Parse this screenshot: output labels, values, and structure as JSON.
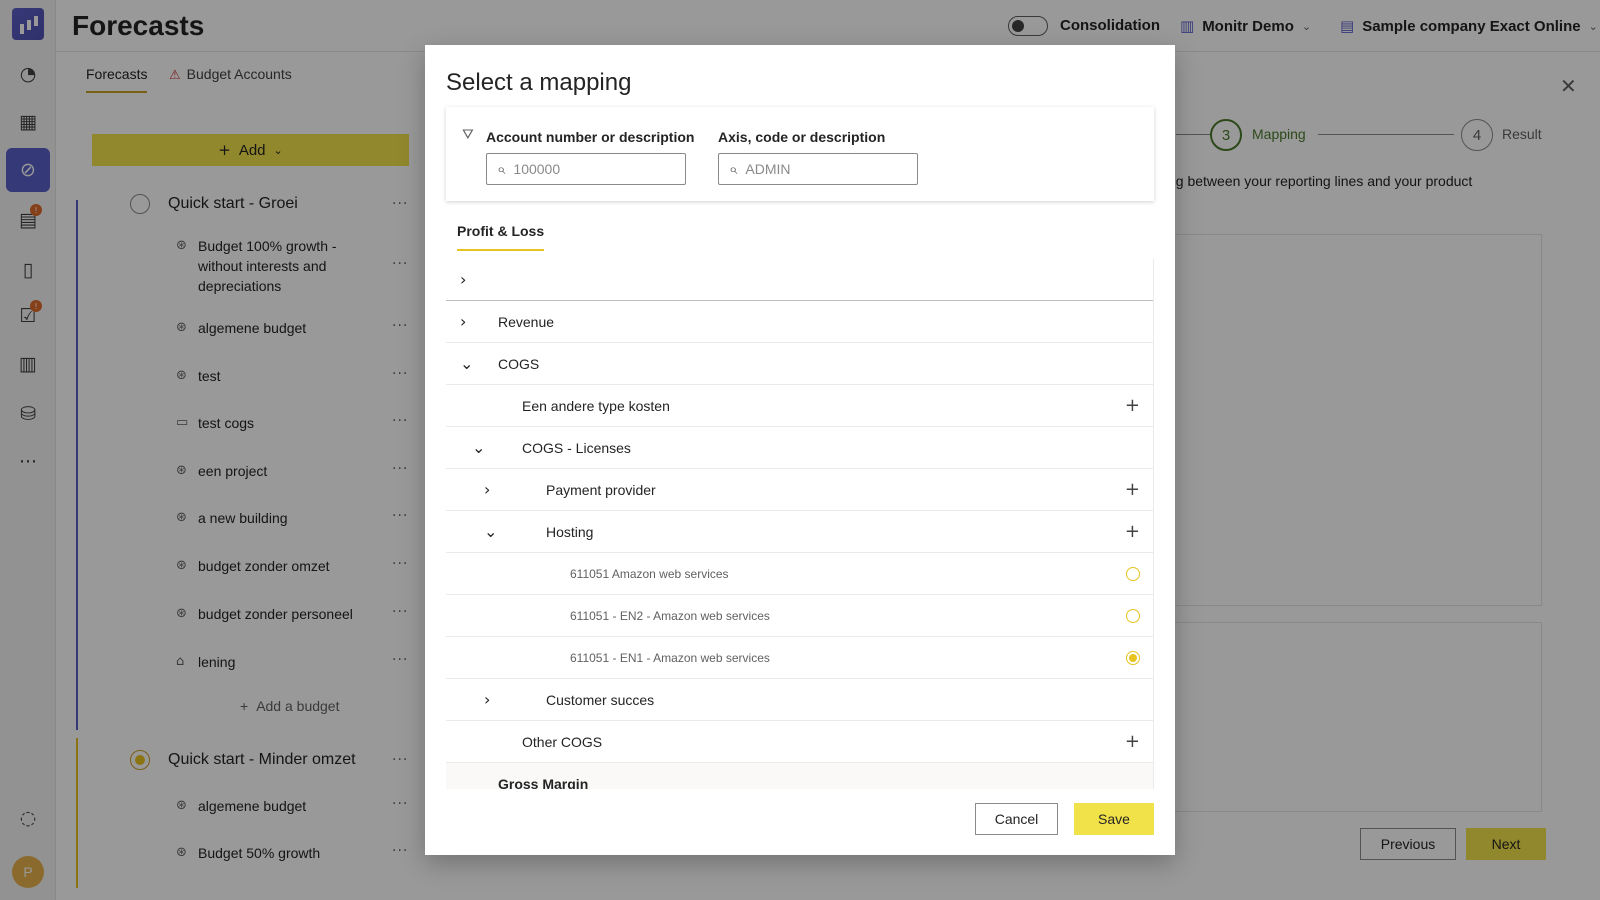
{
  "header": {
    "title": "Forecasts",
    "consolidation_label": "Consolidation",
    "org_menu": "Monitr Demo",
    "company_menu": "Sample company Exact Online"
  },
  "tabs": [
    {
      "label": "Forecasts"
    },
    {
      "label": "Budget Accounts"
    }
  ],
  "left": {
    "add_label": "Add",
    "groups": [
      {
        "name": "Quick start - Groei",
        "items": [
          {
            "label": "Budget 100% growth - without interests and depreciations"
          },
          {
            "label": "algemene budget"
          },
          {
            "label": "test"
          },
          {
            "label": "test cogs"
          },
          {
            "label": "een project"
          },
          {
            "label": "a new building"
          },
          {
            "label": "budget zonder omzet"
          },
          {
            "label": "budget zonder personeel"
          },
          {
            "label": "lening"
          }
        ],
        "add_budget_label": "Add a budget"
      },
      {
        "name": "Quick start - Minder omzet",
        "items": [
          {
            "label": "algemene budget"
          },
          {
            "label": "Budget 50% growth"
          }
        ]
      }
    ]
  },
  "wizard": {
    "steps": [
      {
        "number": "3",
        "label": "Mapping"
      },
      {
        "number": "4",
        "label": "Result"
      }
    ],
    "description": "ng between your reporting lines and your product",
    "previous_label": "Previous",
    "next_label": "Next"
  },
  "modal": {
    "title": "Select a mapping",
    "filter": {
      "account_label": "Account number or description",
      "account_placeholder": "100000",
      "axis_label": "Axis, code or description",
      "axis_placeholder": "ADMIN"
    },
    "tab": "Profit & Loss",
    "tree": [
      {
        "label": "Revenue"
      },
      {
        "label": "COGS"
      },
      {
        "label": "Een andere type kosten"
      },
      {
        "label": "COGS - Licenses"
      },
      {
        "label": "Payment provider"
      },
      {
        "label": "Hosting"
      },
      {
        "label": "611051 Amazon web services"
      },
      {
        "label": "611051 - EN2 - Amazon web services"
      },
      {
        "label": "611051 - EN1 - Amazon web services"
      },
      {
        "label": "Customer succes"
      },
      {
        "label": "Other COGS"
      },
      {
        "label": "Gross Margin"
      }
    ],
    "cancel_label": "Cancel",
    "save_label": "Save"
  },
  "colors": {
    "accent": "#f2e24a",
    "brand": "#5b5fc7",
    "step_active": "#4b7a2a"
  }
}
